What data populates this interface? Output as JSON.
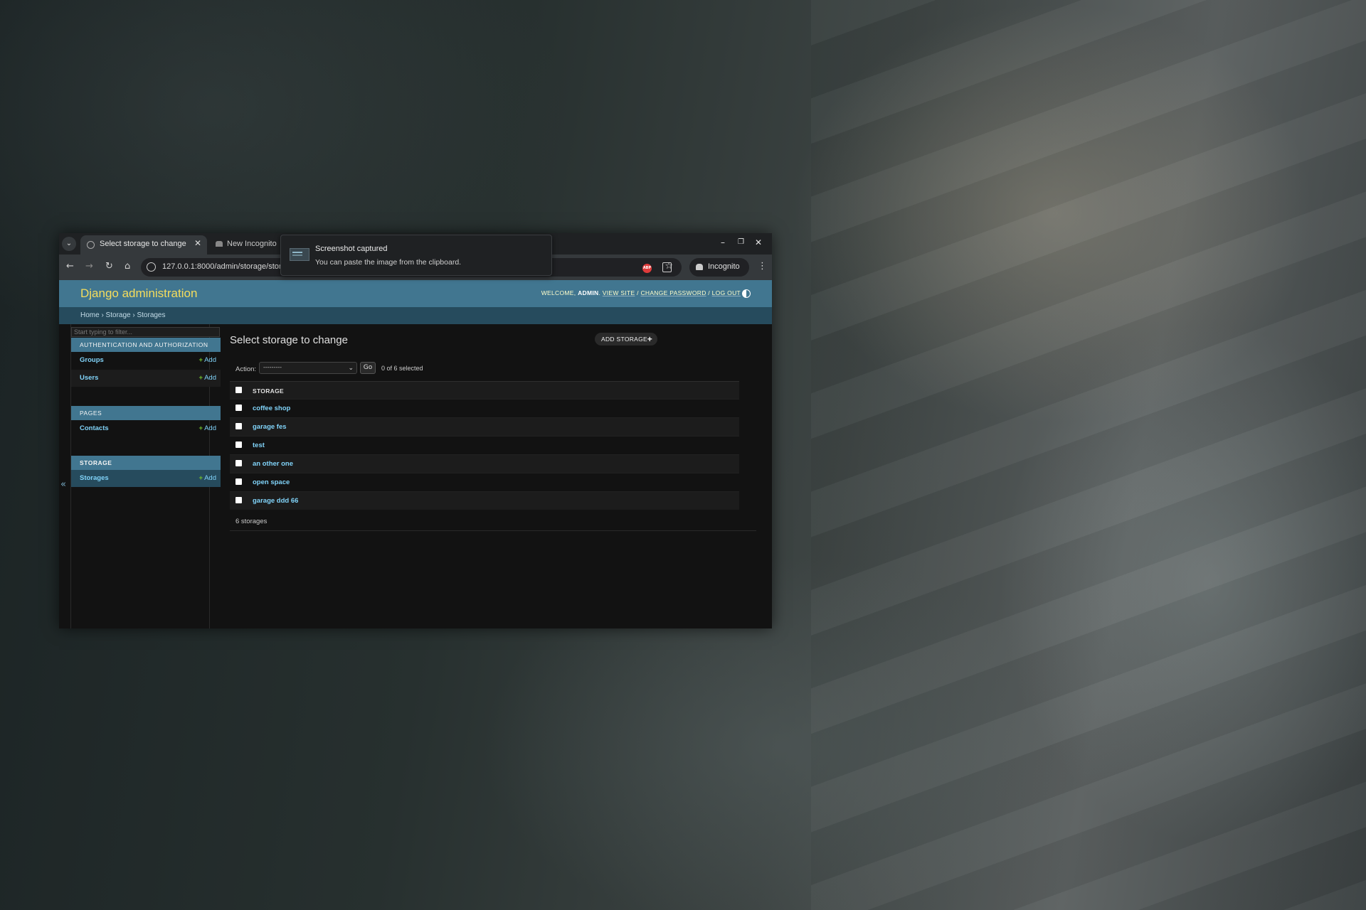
{
  "browser": {
    "active_tab_title": "Select storage to change",
    "inactive_tab_title": "New Incognito",
    "url": "127.0.0.1:8000/admin/storage/stor",
    "incognito_label": "Incognito",
    "window_controls": {
      "minimize": "–",
      "restore": "❐",
      "close": "✕"
    }
  },
  "toast": {
    "title": "Screenshot captured",
    "body": "You can paste the image from the clipboard."
  },
  "header": {
    "branding": "Django administration",
    "welcome": "WELCOME,",
    "username": "ADMIN",
    "view_site": "VIEW SITE",
    "change_password": "CHANGE PASSWORD",
    "log_out": "LOG OUT",
    "separator": " / "
  },
  "breadcrumbs": "Home › Storage › Storages",
  "sidebar": {
    "filter_placeholder": "Start typing to filter...",
    "toggle": "«",
    "modules": [
      {
        "caption": "AUTHENTICATION AND AUTHORIZATION",
        "items": [
          {
            "label": "Groups",
            "add": "Add"
          },
          {
            "label": "Users",
            "add": "Add"
          }
        ]
      },
      {
        "caption": "PAGES",
        "items": [
          {
            "label": "Contacts",
            "add": "Add"
          }
        ]
      },
      {
        "caption": "STORAGE",
        "items": [
          {
            "label": "Storages",
            "add": "Add"
          }
        ]
      }
    ]
  },
  "main": {
    "title": "Select storage to change",
    "add_button": "ADD STORAGE",
    "action_label": "Action:",
    "action_selected": "---------",
    "go_label": "Go",
    "counter": "0 of 6 selected",
    "column_header": "STORAGE",
    "rows": [
      "coffee shop",
      "garage fes",
      "test",
      "an other one",
      "open space",
      "garage ddd 66"
    ],
    "paginator": "6 storages"
  },
  "colors": {
    "header_bg": "#417690",
    "branding": "#f5dd5d",
    "breadcrumbs_bg": "#264b5d",
    "link": "#81d4fa",
    "add_plus": "#70bf2b"
  }
}
